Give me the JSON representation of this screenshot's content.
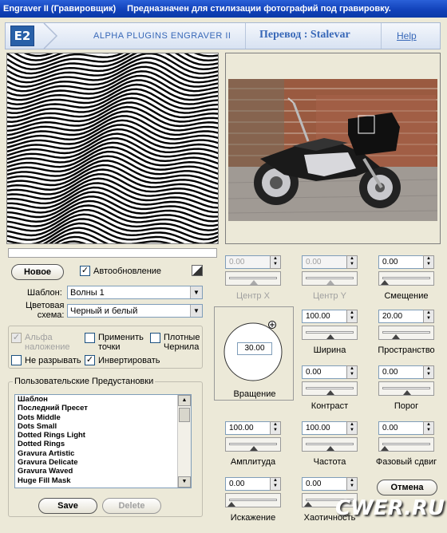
{
  "window": {
    "title": "Engraver II  (Гравировщик)",
    "subtitle": "Предназначен для стилизации фотографий под гравировку."
  },
  "header": {
    "logo": "E2",
    "product_name": "ALPHA PLUGINS ENGRAVER II",
    "translation": "Перевод : Stalevar",
    "help_label": "Help"
  },
  "controls": {
    "new_button": "Новое",
    "autoupdate_label": "Автообновление",
    "autoupdate_checked": true,
    "template_label": "Шаблон:",
    "template_value": "Волны 1",
    "color_scheme_label_1": "Цветовая",
    "color_scheme_label_2": "схема:",
    "color_scheme_value": "Черный и белый"
  },
  "options": {
    "alpha_label_1": "Альфа",
    "alpha_label_2": "наложение",
    "apply_points_label_1": "Применить",
    "apply_points_label_2": "точки",
    "dense_ink_label_1": "Плотные",
    "dense_ink_label_2": "Чернила",
    "no_break_label": "Не разрывать",
    "invert_label": "Инвертировать"
  },
  "presets": {
    "title": "Пользовательские Предустановки",
    "items": [
      "Шаблон",
      "Последний Пресет",
      "Dots Middle",
      "Dots Small",
      "Dotted Rings Light",
      "Dotted Rings",
      "Gravura Artistic",
      "Gravura Delicate",
      "Gravura Waved",
      "Huge Fill Mask"
    ],
    "save_label": "Save",
    "delete_label": "Delete"
  },
  "params": {
    "center_x": {
      "label": "Центр X",
      "value": "0.00"
    },
    "center_y": {
      "label": "Центр Y",
      "value": "0.00"
    },
    "offset": {
      "label": "Смещение",
      "value": "0.00"
    },
    "width": {
      "label": "Ширина",
      "value": "100.00"
    },
    "spacing": {
      "label": "Пространство",
      "value": "20.00"
    },
    "contrast": {
      "label": "Контраст",
      "value": "0.00"
    },
    "threshold": {
      "label": "Порог",
      "value": "0.00"
    },
    "amplitude": {
      "label": "Амплитуда",
      "value": "100.00"
    },
    "frequency": {
      "label": "Частота",
      "value": "100.00"
    },
    "phase": {
      "label": "Фазовый сдвиг",
      "value": "0.00"
    },
    "distortion": {
      "label": "Искажение",
      "value": "0.00"
    },
    "chaos": {
      "label": "Хаотичность",
      "value": "0.00"
    },
    "rotation": {
      "label": "Вращение",
      "value": "30.00"
    }
  },
  "cancel_label": "Отмена",
  "watermark": "CWER.RU"
}
